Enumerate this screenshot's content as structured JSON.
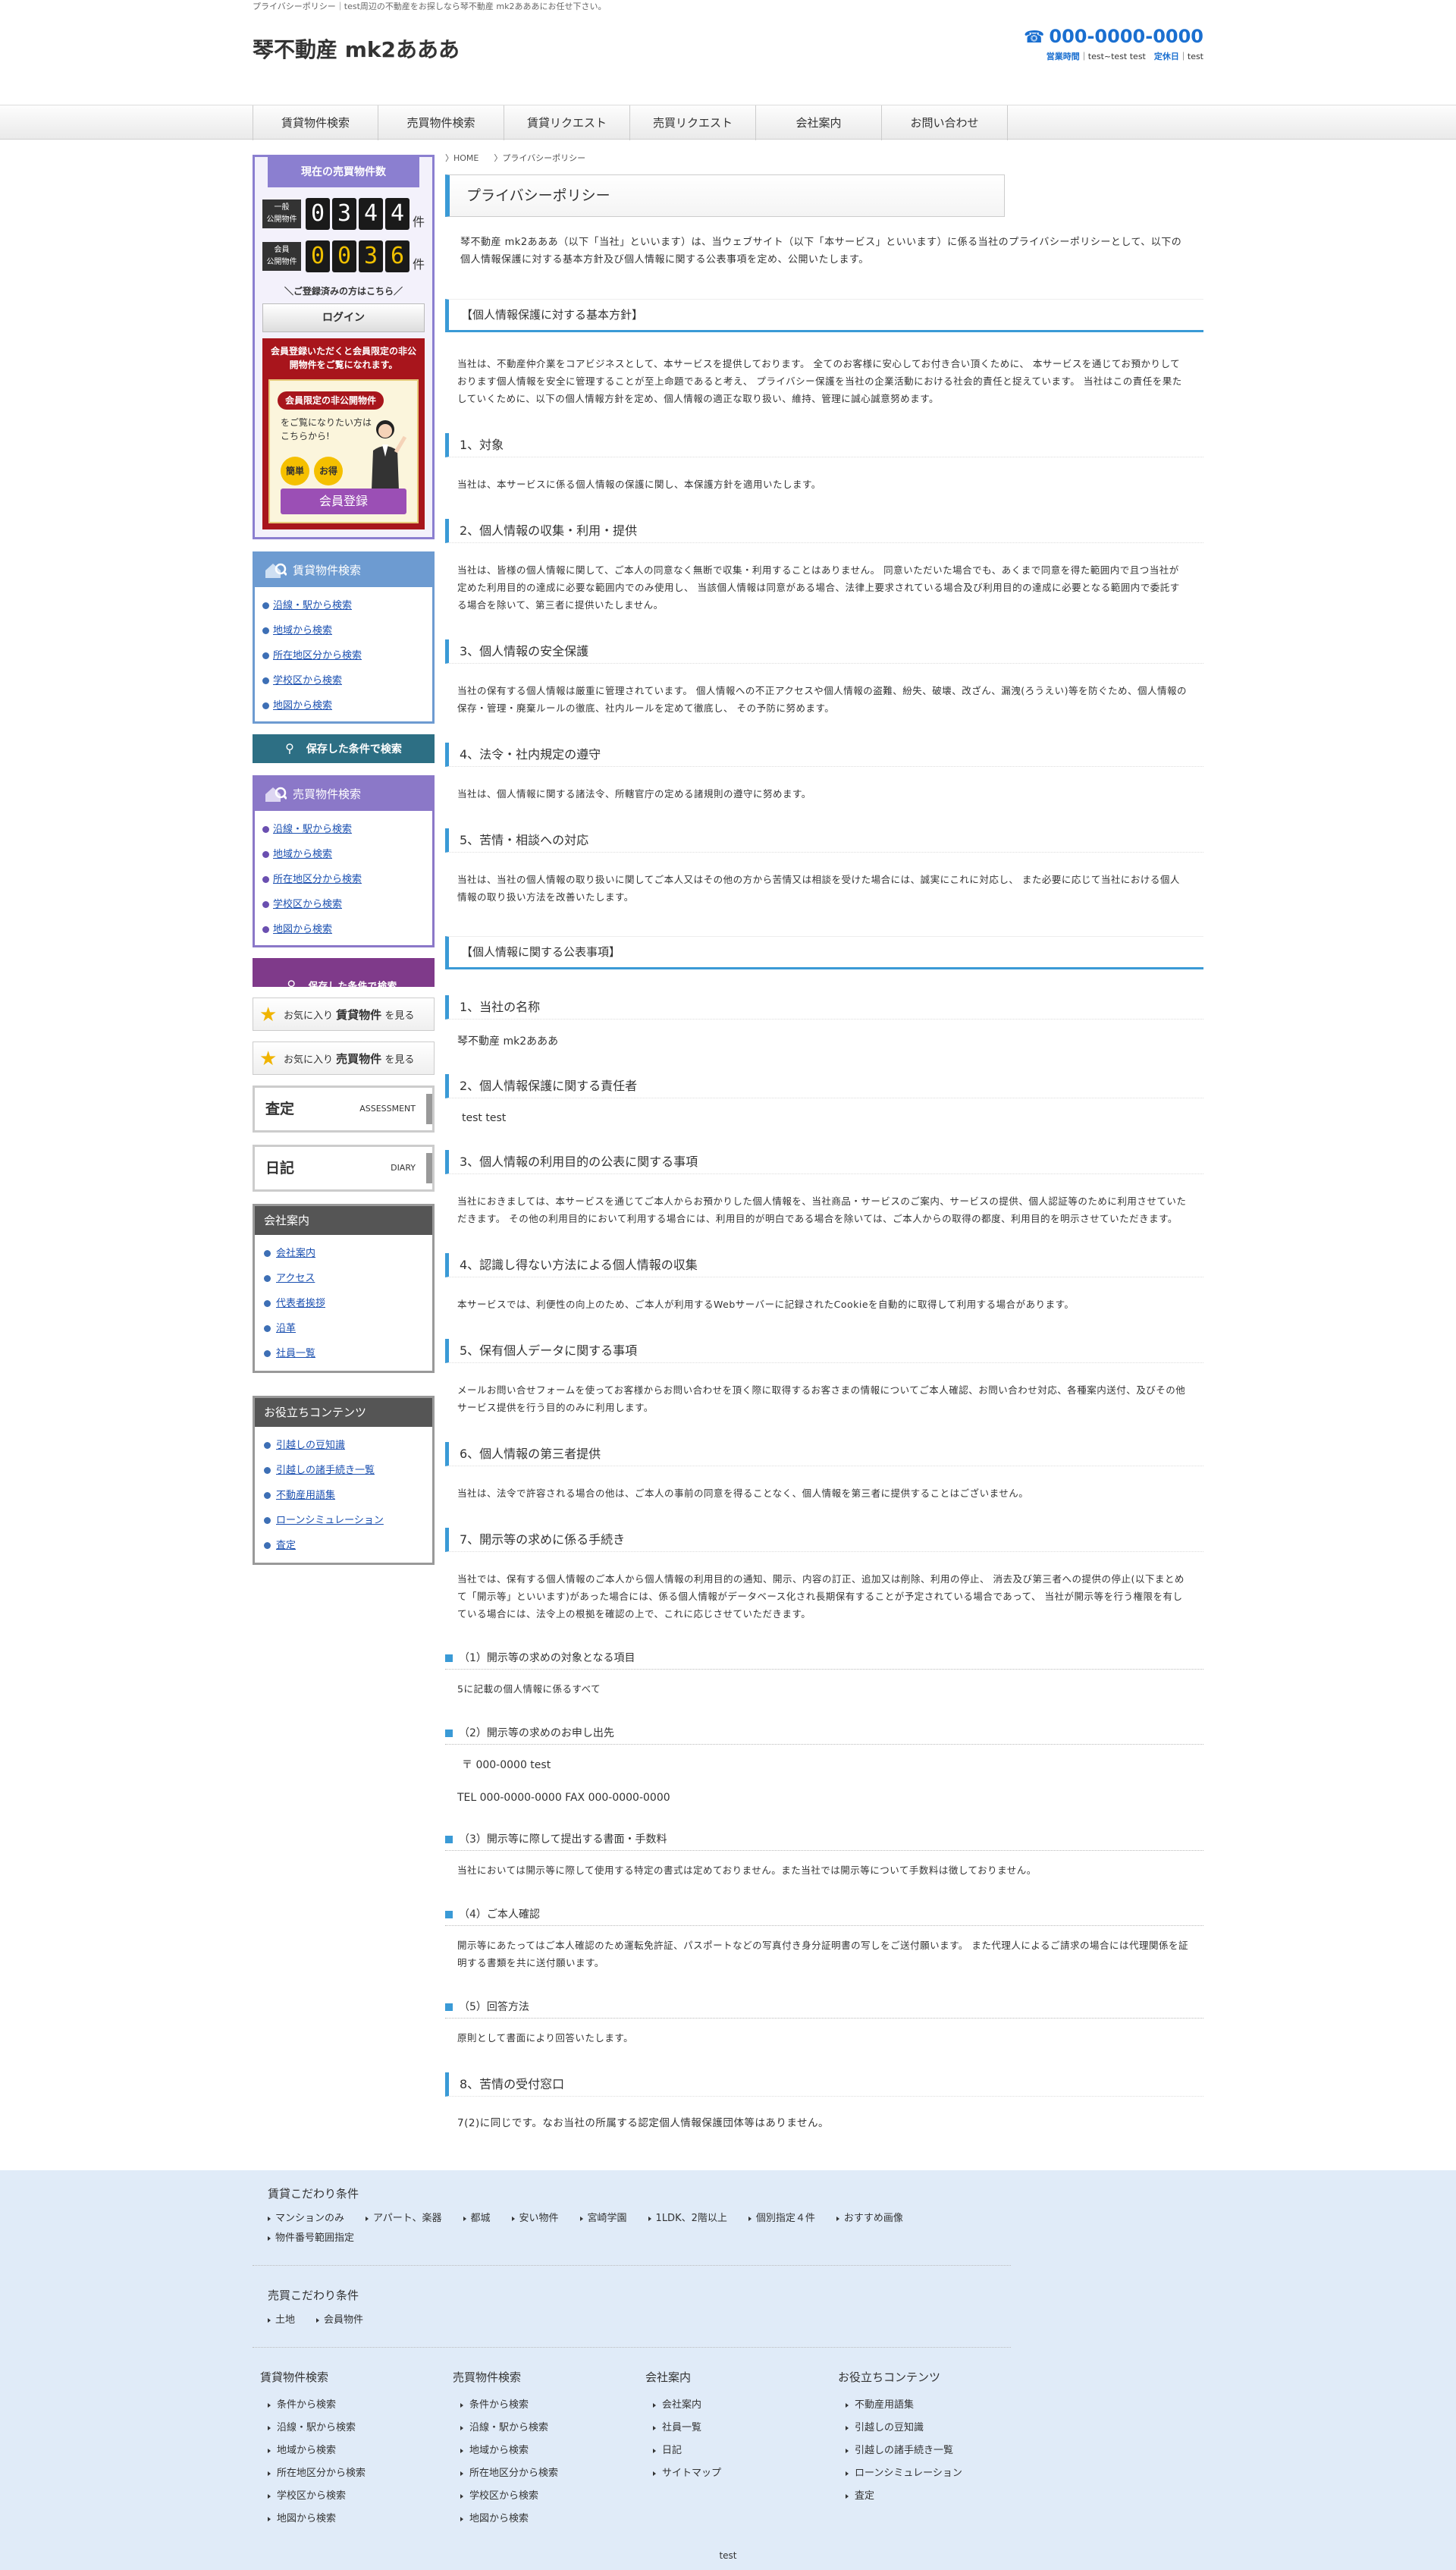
{
  "header": {
    "tagline": "プライバシーポリシー｜test周辺の不動産をお探しなら琴不動産 mk2あああにお任せ下さい。",
    "logo": "琴不動産 mk2あああ",
    "tel": "000-0000-0000",
    "hours_label": "営業時間",
    "hours": "test~test test",
    "holiday_label": "定休日",
    "holiday": "test"
  },
  "nav": [
    "賃貸物件検索",
    "売買物件検索",
    "賃貸リクエスト",
    "売買リクエスト",
    "会社案内",
    "お問い合わせ"
  ],
  "sidebar": {
    "count_title": "現在の売買物件数",
    "public_label": "一般\n公開物件",
    "public_digits": [
      "0",
      "3",
      "4",
      "4"
    ],
    "member_label": "会員\n公開物件",
    "member_digits": [
      "0",
      "0",
      "3",
      "6"
    ],
    "ken": "件",
    "already": "＼ご登録済みの方はこちら／",
    "login": "ログイン",
    "promo_text": "会員登録いただくと会員限定の非公開物件をご覧になれます。",
    "promo_badge": "会員限定の非公開物件",
    "promo_body": "をご覧になりたい方は\nこちらから!",
    "promo_c1": "簡単",
    "promo_c2": "お得",
    "register": "会員登録",
    "rent_title": "賃貸物件検索",
    "rent_links": [
      "沿線・駅から検索",
      "地域から検索",
      "所在地区分から検索",
      "学校区から検索",
      "地図から検索"
    ],
    "rent_save": "保存した条件で検索",
    "sale_title": "売買物件検索",
    "sale_links": [
      "沿線・駅から検索",
      "地域から検索",
      "所在地区分から検索",
      "学校区から検索",
      "地図から検索"
    ],
    "sale_save": "保存した条件で検索",
    "fav1_pre": "お気に入り",
    "fav1_b": "賃貸物件",
    "fav1_post": "を見る",
    "fav2_pre": "お気に入り",
    "fav2_b": "売買物件",
    "fav2_post": "を見る",
    "assess": "査定",
    "assess_en": "ASSESSMENT",
    "diary": "日記",
    "diary_en": "DIARY",
    "company_title": "会社案内",
    "company_links": [
      "会社案内",
      "アクセス",
      "代表者挨拶",
      "沿革",
      "社員一覧"
    ],
    "useful_title": "お役立ちコンテンツ",
    "useful_links": [
      "引越しの豆知識",
      "引越しの諸手続き一覧",
      "不動産用語集",
      "ローンシミュレーション",
      "査定"
    ]
  },
  "breadcrumb": [
    "HOME",
    "プライバシーポリシー"
  ],
  "page_title": "プライバシーポリシー",
  "intro": "琴不動産 mk2あああ（以下「当社」といいます）は、当ウェブサイト（以下「本サービス」といいます）に係る当社のプライバシーポリシーとして、以下の個人情報保護に対する基本方針及び個人情報に関する公表事項を定め、公開いたします。",
  "sec1": "【個人情報保護に対する基本方針】",
  "sec1_p": "当社は、不動産仲介業をコアビジネスとして、本サービスを提供しております。 全てのお客様に安心してお付き合い頂くために、 本サービスを通じてお預かりしております個人情報を安全に管理することが至上命題であると考え、 プライバシー保護を当社の企業活動における社会的責任と捉えています。 当社はこの責任を果たしていくために、以下の個人情報方針を定め、個人情報の適正な取り扱い、維持、管理に誠心誠意努めます。",
  "s1": [
    {
      "h": "1、対象",
      "p": "当社は、本サービスに係る個人情報の保護に関し、本保護方針を適用いたします。"
    },
    {
      "h": "2、個人情報の収集・利用・提供",
      "p": "当社は、皆様の個人情報に関して、ご本人の同意なく無断で収集・利用することはありません。 同意いただいた場合でも、あくまで同意を得た範囲内で且つ当社が定めた利用目的の達成に必要な範囲内でのみ使用し、 当該個人情報は同意がある場合、法律上要求されている場合及び利用目的の達成に必要となる範囲内で委託する場合を除いて、第三者に提供いたしません。"
    },
    {
      "h": "3、個人情報の安全保護",
      "p": "当社の保有する個人情報は厳重に管理されています。 個人情報への不正アクセスや個人情報の盗難、紛失、破壊、改ざん、漏洩(ろうえい)等を防ぐため、個人情報の保存・管理・廃棄ルールの徹底、社内ルールを定めて徹底し、 その予防に努めます。"
    },
    {
      "h": "4、法令・社内規定の遵守",
      "p": "当社は、個人情報に関する諸法令、所轄官庁の定める諸規則の遵守に努めます。"
    },
    {
      "h": "5、苦情・相談への対応",
      "p": "当社は、当社の個人情報の取り扱いに関してご本人又はその他の方から苦情又は相談を受けた場合には、誠実にこれに対応し、 また必要に応じて当社における個人情報の取り扱い方法を改善いたします。"
    }
  ],
  "sec2": "【個人情報に関する公表事項】",
  "s2a": [
    {
      "h": "1、当社の名称",
      "p": "琴不動産 mk2あああ"
    },
    {
      "h": "2、個人情報保護に関する責任者",
      "p": "test test"
    }
  ],
  "s2b": [
    {
      "h": "3、個人情報の利用目的の公表に関する事項",
      "p": "当社におきましては、本サービスを通じてご本人からお預かりした個人情報を、当社商品・サービスのご案内、サービスの提供、個人認証等のために利用させていただきます。 その他の利用目的において利用する場合には、利用目的が明白である場合を除いては、ご本人からの取得の都度、利用目的を明示させていただきます。"
    },
    {
      "h": "4、認識し得ない方法による個人情報の収集",
      "p": "本サービスでは、利便性の向上のため、ご本人が利用するWebサーバーに記録されたCookieを自動的に取得して利用する場合があります。"
    },
    {
      "h": "5、保有個人データに関する事項",
      "p": "メールお問い合せフォームを使ってお客様からお問い合わせを頂く際に取得するお客さまの情報についてご本人確認、お問い合わせ対応、各種案内送付、及びその他サービス提供を行う目的のみに利用します。"
    },
    {
      "h": "6、個人情報の第三者提供",
      "p": "当社は、法令で許容される場合の他は、ご本人の事前の同意を得ることなく、個人情報を第三者に提供することはございません。"
    },
    {
      "h": "7、開示等の求めに係る手続き",
      "p": "当社では、保有する個人情報のご本人から個人情報の利用目的の通知、開示、内容の訂正、追加又は削除、利用の停止、 消去及び第三者への提供の停止(以下まとめて「開示等」といいます)があった場合には、係る個人情報がデータベース化され長期保有することが予定されている場合であって、 当社が開示等を行う権限を有している場合には、法令上の根拠を確認の上で、これに応じさせていただきます。"
    }
  ],
  "s4": [
    {
      "h": "（1）開示等の求めの対象となる項目",
      "p": "5に記載の個人情報に係るすべて"
    }
  ],
  "s4_2": {
    "h": "（2）開示等の求めのお申し出先",
    "addr": "〒 000-0000 test",
    "tel": "TEL 000-0000-0000 FAX 000-0000-0000"
  },
  "s4b": [
    {
      "h": "（3）開示等に際して提出する書面・手数料",
      "p": "当社においては開示等に際して使用する特定の書式は定めておりません。また当社では開示等について手数料は徴しておりません。"
    },
    {
      "h": "（4）ご本人確認",
      "p": "開示等にあたってはご本人確認のため運転免許証、パスポートなどの写真付き身分証明書の写しをご送付願います。 また代理人によるご請求の場合には代理関係を証明する書類を共に送付願います。"
    },
    {
      "h": "（5）回答方法",
      "p": "原則として書面により回答いたします。"
    }
  ],
  "s5": {
    "h": "8、苦情の受付窓口",
    "p": "7(2)に同じです。なお当社の所属する認定個人情報保護団体等はありません。"
  },
  "footer": {
    "rent_title": "賃貸こだわり条件",
    "rent_tags": [
      "マンションのみ",
      "アパート、楽器",
      "都城",
      "安い物件",
      "宮崎学園",
      "1LDK、2階以上",
      "個別指定４件",
      "おすすめ画像",
      "物件番号範囲指定"
    ],
    "sale_title": "売買こだわり条件",
    "sale_tags": [
      "土地",
      "会員物件"
    ],
    "cols": [
      {
        "t": "賃貸物件検索",
        "items": [
          "条件から検索",
          "沿線・駅から検索",
          "地域から検索",
          "所在地区分から検索",
          "学校区から検索",
          "地図から検索"
        ]
      },
      {
        "t": "売買物件検索",
        "items": [
          "条件から検索",
          "沿線・駅から検索",
          "地域から検索",
          "所在地区分から検索",
          "学校区から検索",
          "地図から検索"
        ]
      },
      {
        "t": "会社案内",
        "items": [
          "会社案内",
          "社員一覧",
          "日記",
          "サイトマップ"
        ]
      },
      {
        "t": "お役立ちコンテンツ",
        "items": [
          "不動産用語集",
          "引越しの豆知識",
          "引越しの諸手続き一覧",
          "ローンシミュレーション",
          "査定"
        ]
      }
    ],
    "copy": "test"
  }
}
